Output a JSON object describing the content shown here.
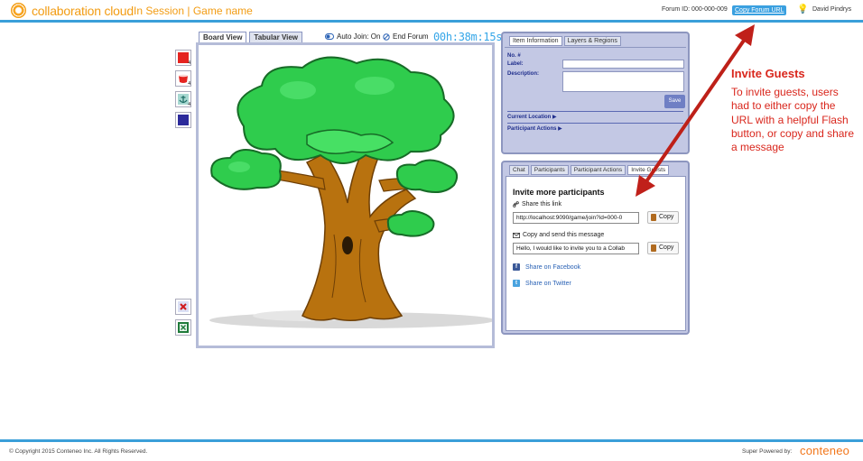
{
  "header": {
    "logo_text": "collaboration cloud",
    "session_text": "In Session | Game name",
    "forum_id": "Forum ID: 000-000-009",
    "copy_forum_url": "Copy Forum URL",
    "user_name": "David Pindrys",
    "brand_color": "#f29c13",
    "accent_color": "#3a9fd9"
  },
  "board": {
    "tabs": [
      {
        "label": "Board View",
        "active": true
      },
      {
        "label": "Tabular View",
        "active": false
      }
    ],
    "auto_join": "Auto Join: On",
    "end_forum": "End Forum",
    "timer": "00h:38m:15s"
  },
  "tools": [
    {
      "name": "red-square-icon",
      "color": "#e52420",
      "count": "4"
    },
    {
      "name": "red-cup-icon",
      "color": "#e52420",
      "count": "4"
    },
    {
      "name": "anchor-icon",
      "color": "#1a8a7e",
      "count": "4"
    },
    {
      "name": "navy-square-icon",
      "color": "#2c2a9b",
      "count": ""
    }
  ],
  "item_info": {
    "tabs": [
      {
        "label": "Item Information",
        "active": true
      },
      {
        "label": "Layers & Regions",
        "active": false
      }
    ],
    "no_label": "No. #",
    "label_label": "Label:",
    "description_label": "Description:",
    "save": "Save",
    "current_location": "Current Location ▶",
    "participant_actions": "Participant Actions ▶"
  },
  "chat": {
    "tabs": [
      {
        "label": "Chat",
        "active": false
      },
      {
        "label": "Participants",
        "active": false
      },
      {
        "label": "Participant Actions",
        "active": false
      },
      {
        "label": "Invite Guests",
        "active": true
      }
    ],
    "title": "Invite more participants",
    "share_link_label": "Share this link",
    "link_value": "http://localhost:9090/game/join?id=000-0",
    "message_label": "Copy and send this message",
    "message_value": "Hello, I would like to invite you to a Collab",
    "copy": "Copy",
    "facebook": "Share on Facebook",
    "twitter": "Share on Twitter"
  },
  "annotation": {
    "title": "Invite Guests",
    "body": "To invite guests, users had to either copy the URL with a helpful Flash button, or copy and share a message"
  },
  "footer": {
    "copyright": "© Copyright 2015 Conteneo Inc. All Rights Reserved.",
    "powered": "Super Powered by:",
    "brand": "conteneo"
  }
}
